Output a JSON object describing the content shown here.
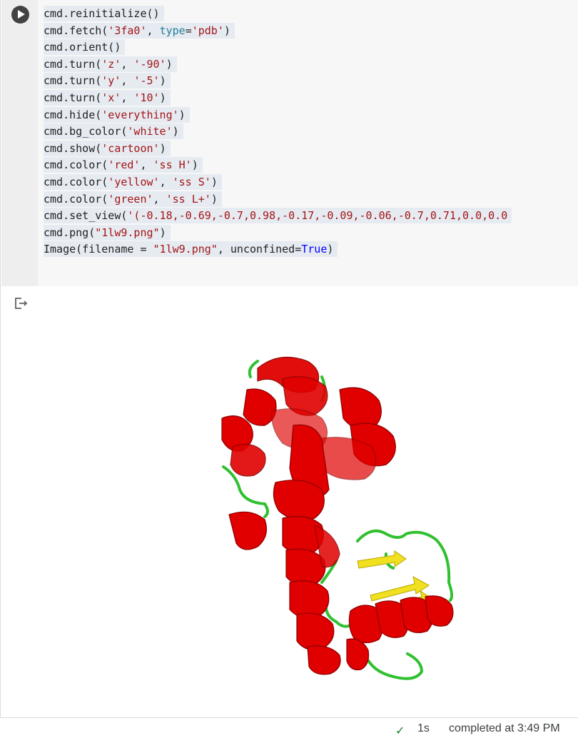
{
  "cell": {
    "code_lines": [
      [
        {
          "t": "cmd.reinitialize()",
          "c": "plain"
        }
      ],
      [
        {
          "t": "cmd.fetch(",
          "c": "plain"
        },
        {
          "t": "'3fa0'",
          "c": "str"
        },
        {
          "t": ", ",
          "c": "plain"
        },
        {
          "t": "type",
          "c": "kw"
        },
        {
          "t": "=",
          "c": "plain"
        },
        {
          "t": "'pdb'",
          "c": "str"
        },
        {
          "t": ")",
          "c": "plain"
        }
      ],
      [
        {
          "t": "cmd.orient()",
          "c": "plain"
        }
      ],
      [
        {
          "t": "cmd.turn(",
          "c": "plain"
        },
        {
          "t": "'z'",
          "c": "str"
        },
        {
          "t": ", ",
          "c": "plain"
        },
        {
          "t": "'-90'",
          "c": "str"
        },
        {
          "t": ")",
          "c": "plain"
        }
      ],
      [
        {
          "t": "cmd.turn(",
          "c": "plain"
        },
        {
          "t": "'y'",
          "c": "str"
        },
        {
          "t": ", ",
          "c": "plain"
        },
        {
          "t": "'-5'",
          "c": "str"
        },
        {
          "t": ")",
          "c": "plain"
        }
      ],
      [
        {
          "t": "cmd.turn(",
          "c": "plain"
        },
        {
          "t": "'x'",
          "c": "str"
        },
        {
          "t": ", ",
          "c": "plain"
        },
        {
          "t": "'10'",
          "c": "str"
        },
        {
          "t": ")",
          "c": "plain"
        }
      ],
      [
        {
          "t": "cmd.hide(",
          "c": "plain"
        },
        {
          "t": "'everything'",
          "c": "str"
        },
        {
          "t": ")",
          "c": "plain"
        }
      ],
      [
        {
          "t": "cmd.bg_color(",
          "c": "plain"
        },
        {
          "t": "'white'",
          "c": "str"
        },
        {
          "t": ")",
          "c": "plain"
        }
      ],
      [
        {
          "t": "cmd.show(",
          "c": "plain"
        },
        {
          "t": "'cartoon'",
          "c": "str"
        },
        {
          "t": ")",
          "c": "plain"
        }
      ],
      [
        {
          "t": "cmd.color(",
          "c": "plain"
        },
        {
          "t": "'red'",
          "c": "str"
        },
        {
          "t": ", ",
          "c": "plain"
        },
        {
          "t": "'ss H'",
          "c": "str"
        },
        {
          "t": ")",
          "c": "plain"
        }
      ],
      [
        {
          "t": "cmd.color(",
          "c": "plain"
        },
        {
          "t": "'yellow'",
          "c": "str"
        },
        {
          "t": ", ",
          "c": "plain"
        },
        {
          "t": "'ss S'",
          "c": "str"
        },
        {
          "t": ")",
          "c": "plain"
        }
      ],
      [
        {
          "t": "cmd.color(",
          "c": "plain"
        },
        {
          "t": "'green'",
          "c": "str"
        },
        {
          "t": ", ",
          "c": "plain"
        },
        {
          "t": "'ss L+'",
          "c": "str"
        },
        {
          "t": ")",
          "c": "plain"
        }
      ],
      [
        {
          "t": "cmd.set_view(",
          "c": "plain"
        },
        {
          "t": "'(-0.18,-0.69,-0.7,0.98,-0.17,-0.09,-0.06,-0.7,0.71,0.0,0.0",
          "c": "str"
        }
      ],
      [
        {
          "t": "cmd.png(",
          "c": "plain"
        },
        {
          "t": "\"1lw9.png\"",
          "c": "str"
        },
        {
          "t": ")",
          "c": "plain"
        }
      ],
      [
        {
          "t": "Image(filename = ",
          "c": "plain"
        },
        {
          "t": "\"1lw9.png\"",
          "c": "str"
        },
        {
          "t": ", unconfined=",
          "c": "plain"
        },
        {
          "t": "True",
          "c": "blue"
        },
        {
          "t": ")",
          "c": "plain"
        }
      ]
    ],
    "run_icon": "play-icon",
    "output_icon": "output-arrow-icon"
  },
  "status": {
    "check_icon": "checkmark-icon",
    "check_glyph": "✓",
    "duration": "1s",
    "completed": "completed at 3:49 PM"
  },
  "colors": {
    "helix": "#e00000",
    "sheet": "#f0e020",
    "loop": "#30c030",
    "string": "#a31515",
    "keyword": "#267f99",
    "constant": "#0000ff",
    "check": "#188038"
  }
}
